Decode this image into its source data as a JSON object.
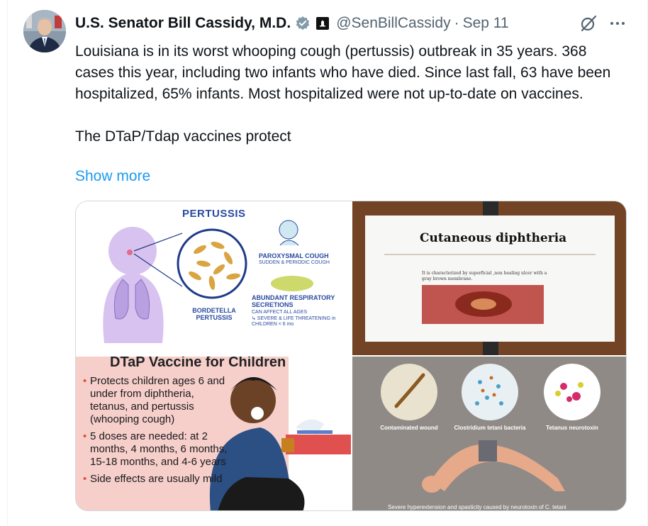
{
  "tweet": {
    "author_name": "U.S. Senator Bill Cassidy, M.D.",
    "handle": "@SenBillCassidy",
    "separator": "·",
    "date": "Sep 11",
    "text_paragraph_1": "Louisiana is in its worst whooping cough (pertussis) outbreak in 35 years. 368 cases this year, including two infants who have died. Since last fall, 63 have been hospitalized, 65% infants. Most hospitalized were not up-to-date on vaccines.",
    "text_paragraph_2": "The DTaP/Tdap vaccines protect",
    "show_more": "Show more"
  },
  "icons": {
    "verified": "verified-badge-icon",
    "government": "government-building-icon",
    "grok": "grok-icon",
    "more": "more-options-icon"
  },
  "colors": {
    "link": "#1d9bf0",
    "secondary_text": "#536471",
    "verified_gray": "#829aab"
  },
  "media": {
    "pertussis": {
      "title": "PERTUSSIS",
      "bacteria_label": "BORDETELLA PERTUSSIS",
      "cough_label": "PAROXYSMAL COUGH",
      "cough_sub": "SUDDEN & PERIODIC COUGH",
      "secretions_label": "ABUNDANT RESPIRATORY SECRETIONS",
      "ages_note": "CAN AFFECT ALL AGES",
      "severe_note": "↳ SEVERE & LIFE THREATENING in CHILDREN < 6 mo"
    },
    "diphtheria": {
      "title": "Cutaneous diphtheria",
      "description": "It is characterized by superficial ,non healing ulcer with a gray brown membrane."
    },
    "dtap": {
      "title": "DTaP Vaccine for Children",
      "bullets": [
        "Protects children ages 6 and under from diphtheria, tetanus, and pertussis (whooping cough)",
        "5 doses are needed: at 2 months, 4 months, 6 months, 15-18 months, and 4-6 years",
        "Side effects are usually mild"
      ]
    },
    "tetanus": {
      "captions": [
        "Contaminated wound",
        "Clostridium tetani bacteria",
        "Tetanus neurotoxin"
      ],
      "bottom_caption": "Severe hyperextension and spasticity caused by neurotoxin of C. tetani"
    }
  }
}
